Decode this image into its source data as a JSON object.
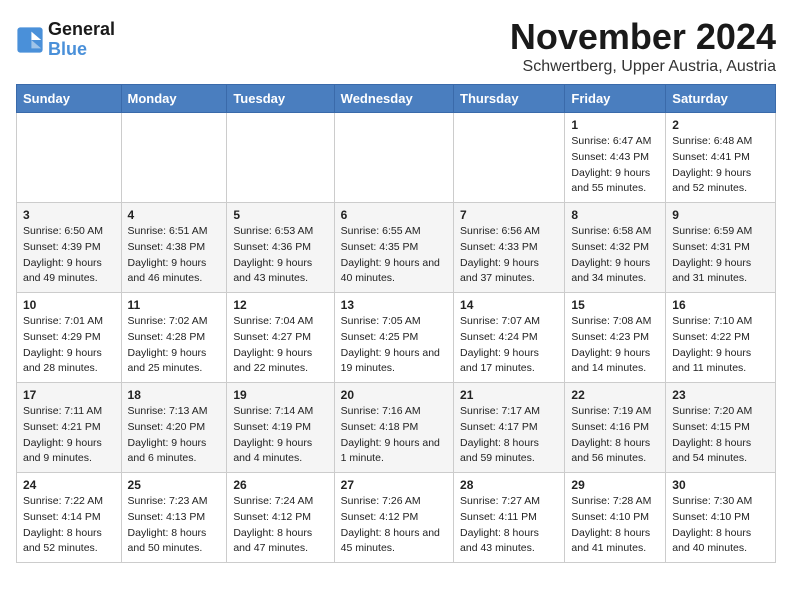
{
  "logo": {
    "text_general": "General",
    "text_blue": "Blue"
  },
  "header": {
    "title": "November 2024",
    "subtitle": "Schwertberg, Upper Austria, Austria"
  },
  "days_of_week": [
    "Sunday",
    "Monday",
    "Tuesday",
    "Wednesday",
    "Thursday",
    "Friday",
    "Saturday"
  ],
  "weeks": [
    [
      {
        "day": "",
        "info": ""
      },
      {
        "day": "",
        "info": ""
      },
      {
        "day": "",
        "info": ""
      },
      {
        "day": "",
        "info": ""
      },
      {
        "day": "",
        "info": ""
      },
      {
        "day": "1",
        "info": "Sunrise: 6:47 AM\nSunset: 4:43 PM\nDaylight: 9 hours and 55 minutes."
      },
      {
        "day": "2",
        "info": "Sunrise: 6:48 AM\nSunset: 4:41 PM\nDaylight: 9 hours and 52 minutes."
      }
    ],
    [
      {
        "day": "3",
        "info": "Sunrise: 6:50 AM\nSunset: 4:39 PM\nDaylight: 9 hours and 49 minutes."
      },
      {
        "day": "4",
        "info": "Sunrise: 6:51 AM\nSunset: 4:38 PM\nDaylight: 9 hours and 46 minutes."
      },
      {
        "day": "5",
        "info": "Sunrise: 6:53 AM\nSunset: 4:36 PM\nDaylight: 9 hours and 43 minutes."
      },
      {
        "day": "6",
        "info": "Sunrise: 6:55 AM\nSunset: 4:35 PM\nDaylight: 9 hours and 40 minutes."
      },
      {
        "day": "7",
        "info": "Sunrise: 6:56 AM\nSunset: 4:33 PM\nDaylight: 9 hours and 37 minutes."
      },
      {
        "day": "8",
        "info": "Sunrise: 6:58 AM\nSunset: 4:32 PM\nDaylight: 9 hours and 34 minutes."
      },
      {
        "day": "9",
        "info": "Sunrise: 6:59 AM\nSunset: 4:31 PM\nDaylight: 9 hours and 31 minutes."
      }
    ],
    [
      {
        "day": "10",
        "info": "Sunrise: 7:01 AM\nSunset: 4:29 PM\nDaylight: 9 hours and 28 minutes."
      },
      {
        "day": "11",
        "info": "Sunrise: 7:02 AM\nSunset: 4:28 PM\nDaylight: 9 hours and 25 minutes."
      },
      {
        "day": "12",
        "info": "Sunrise: 7:04 AM\nSunset: 4:27 PM\nDaylight: 9 hours and 22 minutes."
      },
      {
        "day": "13",
        "info": "Sunrise: 7:05 AM\nSunset: 4:25 PM\nDaylight: 9 hours and 19 minutes."
      },
      {
        "day": "14",
        "info": "Sunrise: 7:07 AM\nSunset: 4:24 PM\nDaylight: 9 hours and 17 minutes."
      },
      {
        "day": "15",
        "info": "Sunrise: 7:08 AM\nSunset: 4:23 PM\nDaylight: 9 hours and 14 minutes."
      },
      {
        "day": "16",
        "info": "Sunrise: 7:10 AM\nSunset: 4:22 PM\nDaylight: 9 hours and 11 minutes."
      }
    ],
    [
      {
        "day": "17",
        "info": "Sunrise: 7:11 AM\nSunset: 4:21 PM\nDaylight: 9 hours and 9 minutes."
      },
      {
        "day": "18",
        "info": "Sunrise: 7:13 AM\nSunset: 4:20 PM\nDaylight: 9 hours and 6 minutes."
      },
      {
        "day": "19",
        "info": "Sunrise: 7:14 AM\nSunset: 4:19 PM\nDaylight: 9 hours and 4 minutes."
      },
      {
        "day": "20",
        "info": "Sunrise: 7:16 AM\nSunset: 4:18 PM\nDaylight: 9 hours and 1 minute."
      },
      {
        "day": "21",
        "info": "Sunrise: 7:17 AM\nSunset: 4:17 PM\nDaylight: 8 hours and 59 minutes."
      },
      {
        "day": "22",
        "info": "Sunrise: 7:19 AM\nSunset: 4:16 PM\nDaylight: 8 hours and 56 minutes."
      },
      {
        "day": "23",
        "info": "Sunrise: 7:20 AM\nSunset: 4:15 PM\nDaylight: 8 hours and 54 minutes."
      }
    ],
    [
      {
        "day": "24",
        "info": "Sunrise: 7:22 AM\nSunset: 4:14 PM\nDaylight: 8 hours and 52 minutes."
      },
      {
        "day": "25",
        "info": "Sunrise: 7:23 AM\nSunset: 4:13 PM\nDaylight: 8 hours and 50 minutes."
      },
      {
        "day": "26",
        "info": "Sunrise: 7:24 AM\nSunset: 4:12 PM\nDaylight: 8 hours and 47 minutes."
      },
      {
        "day": "27",
        "info": "Sunrise: 7:26 AM\nSunset: 4:12 PM\nDaylight: 8 hours and 45 minutes."
      },
      {
        "day": "28",
        "info": "Sunrise: 7:27 AM\nSunset: 4:11 PM\nDaylight: 8 hours and 43 minutes."
      },
      {
        "day": "29",
        "info": "Sunrise: 7:28 AM\nSunset: 4:10 PM\nDaylight: 8 hours and 41 minutes."
      },
      {
        "day": "30",
        "info": "Sunrise: 7:30 AM\nSunset: 4:10 PM\nDaylight: 8 hours and 40 minutes."
      }
    ]
  ]
}
